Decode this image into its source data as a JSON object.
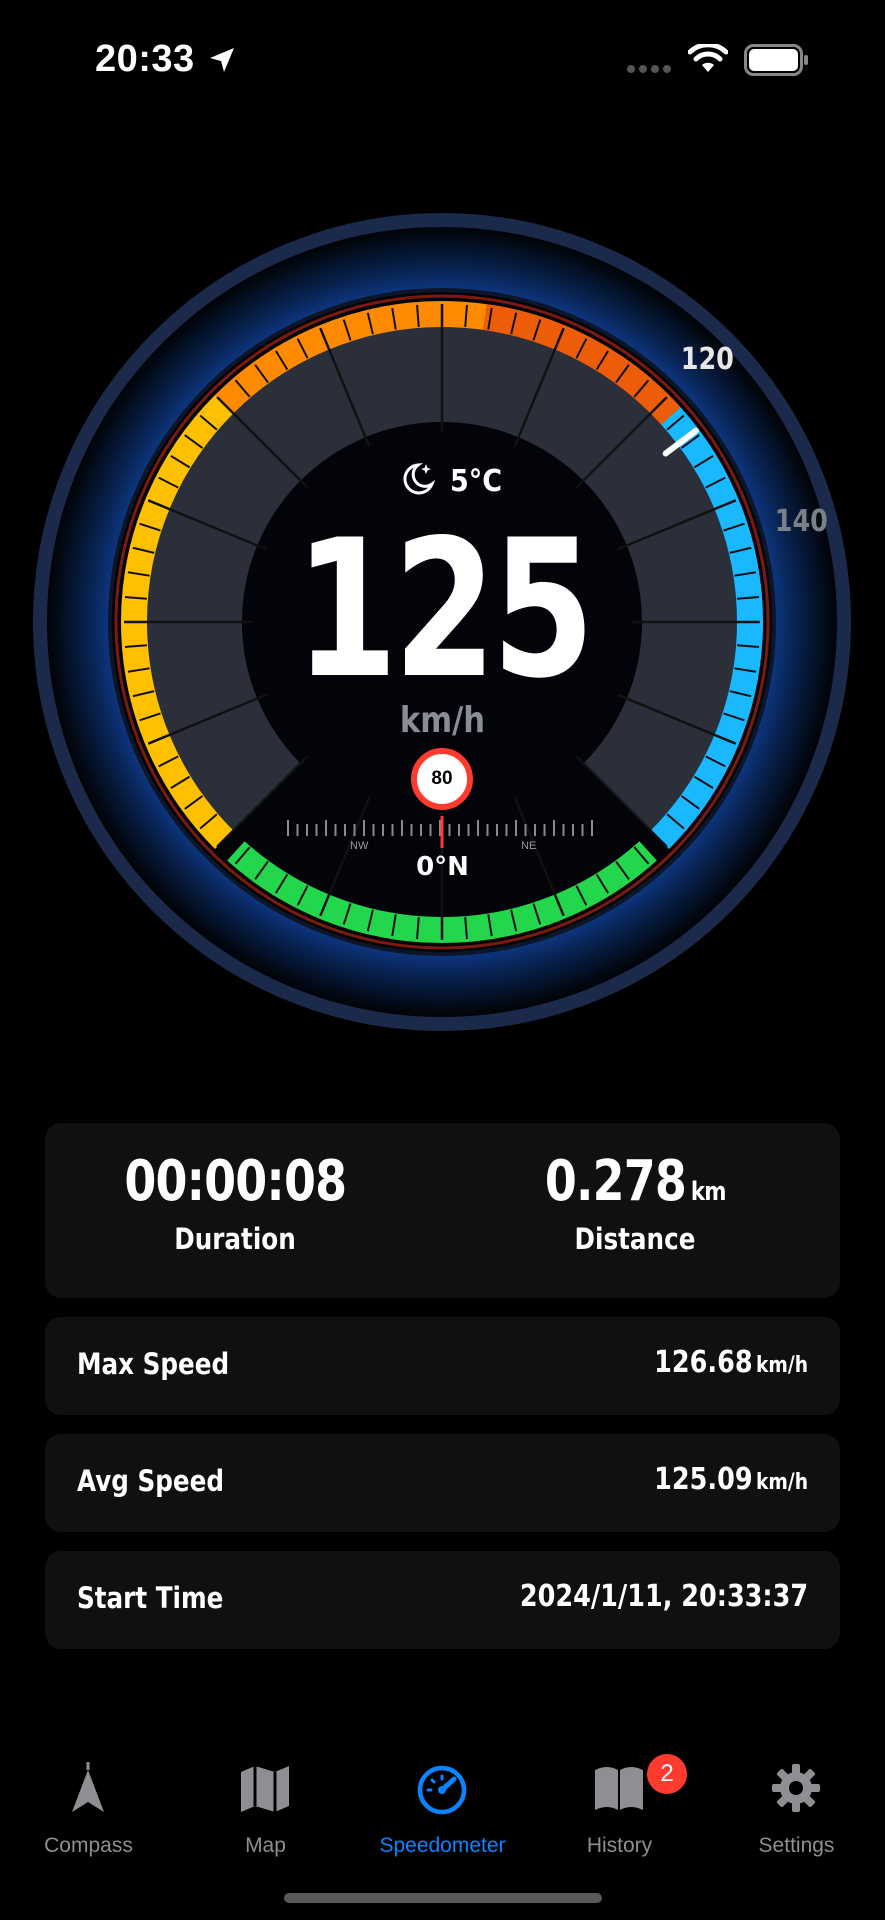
{
  "status_bar": {
    "time": "20:33"
  },
  "gauge": {
    "tick_labels": [
      "120",
      "140"
    ],
    "speed": "125",
    "unit": "km/h",
    "weather_temp": "5°C",
    "speed_limit": "80",
    "heading": "0°N",
    "compass_labels": [
      "NW",
      "NE"
    ],
    "colors": {
      "orange": "#ff8a00",
      "yellow": "#ffc000",
      "green": "#23d64b",
      "blue": "#1ab8ff",
      "red": "#ff3b1f"
    }
  },
  "stats": {
    "duration": {
      "value": "00:00:08",
      "label": "Duration"
    },
    "distance": {
      "value": "0.278",
      "unit": "km",
      "label": "Distance"
    }
  },
  "rows": [
    {
      "label": "Max Speed",
      "value": "126.68",
      "unit": "km/h"
    },
    {
      "label": "Avg Speed",
      "value": "125.09",
      "unit": "km/h"
    },
    {
      "label": "Start Time",
      "value": "2024/1/11, 20:33:37",
      "unit": ""
    }
  ],
  "tabs": [
    {
      "label": "Compass",
      "icon": "compass-icon"
    },
    {
      "label": "Map",
      "icon": "map-icon"
    },
    {
      "label": "Speedometer",
      "icon": "speedometer-icon",
      "active": true
    },
    {
      "label": "History",
      "icon": "book-icon",
      "badge": "2"
    },
    {
      "label": "Settings",
      "icon": "gear-icon"
    }
  ],
  "accent_color": "#0a84ff"
}
